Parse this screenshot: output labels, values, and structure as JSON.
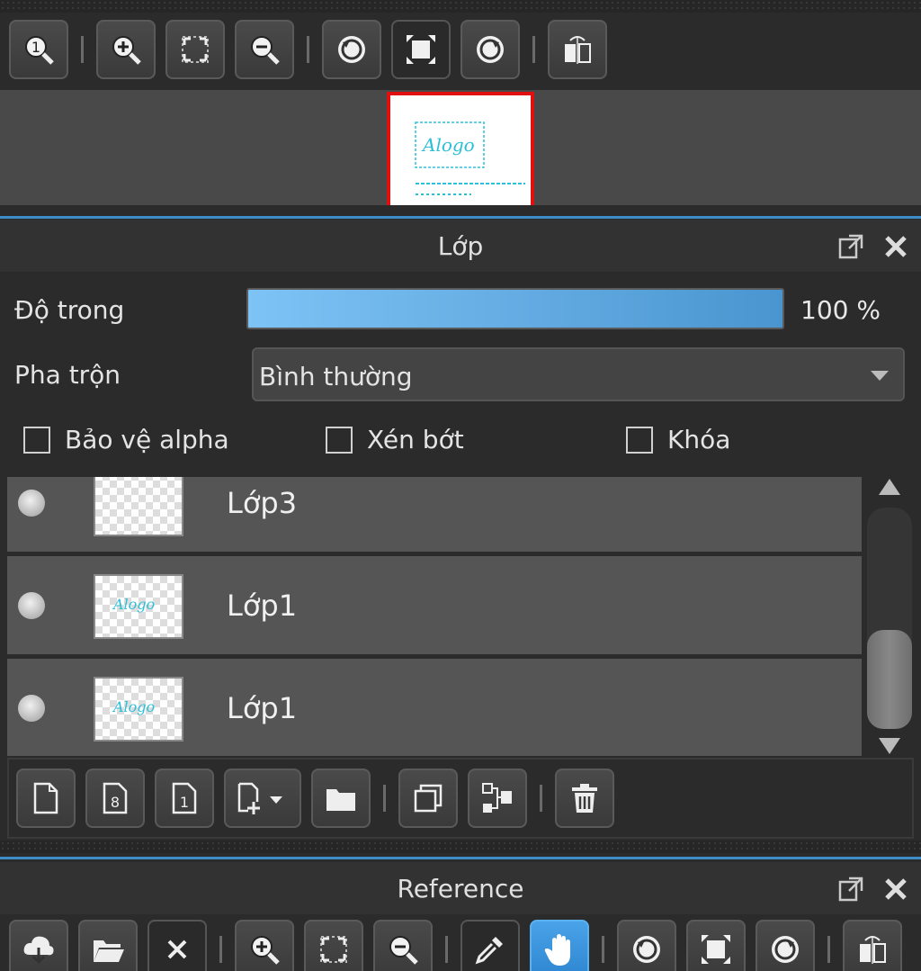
{
  "navigator": {
    "toolbar": [
      {
        "name": "zoom-actual-icon"
      },
      {
        "name": "zoom-in-icon"
      },
      {
        "name": "fit-screen-icon"
      },
      {
        "name": "zoom-out-icon"
      },
      {
        "name": "rotate-left-icon"
      },
      {
        "name": "reset-view-icon"
      },
      {
        "name": "rotate-right-icon"
      },
      {
        "name": "flip-horizontal-icon"
      }
    ],
    "thumb_text": "Alogo"
  },
  "layer_panel": {
    "title": "Lớp",
    "opacity_label": "Độ trong",
    "opacity_value": "100 %",
    "opacity_fraction": 1.0,
    "blend_label": "Pha trộn",
    "blend_value": "Bình thường",
    "checkboxes": {
      "alpha_protect": "Bảo vệ alpha",
      "clipping": "Xén bớt",
      "lock": "Khóa"
    },
    "layers": [
      {
        "name": "Lớp3",
        "has_art": false
      },
      {
        "name": "Lớp1",
        "has_art": true,
        "art_text": "Alogo"
      },
      {
        "name": "Lớp1",
        "has_art": true,
        "art_text": "Alogo"
      }
    ]
  },
  "reference_panel": {
    "title": "Reference"
  },
  "colors": {
    "accent": "#3c8dc8",
    "active_tool": "#2d86d0",
    "nav_border": "#e01010",
    "art": "#2cc0d8"
  }
}
